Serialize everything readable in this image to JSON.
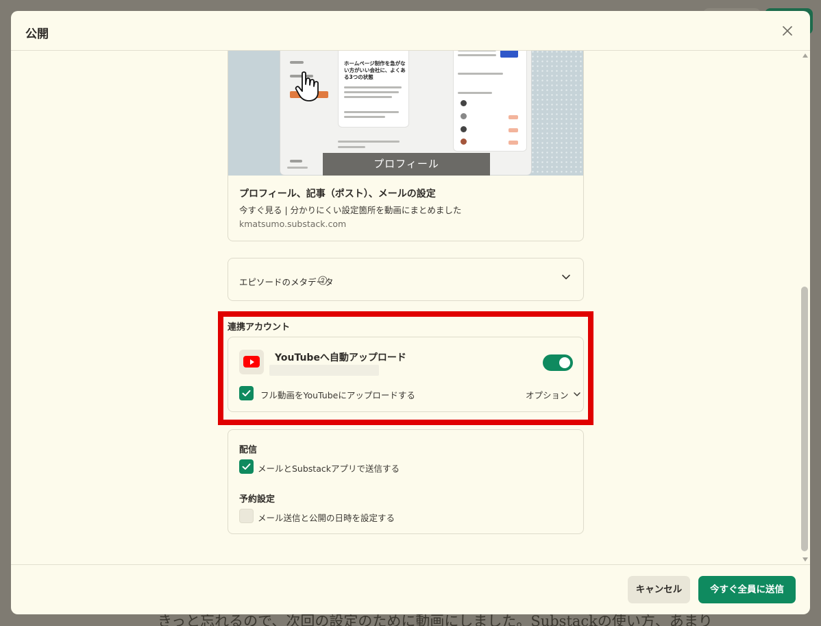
{
  "background": {
    "article_text": "きっと忘れるので、次回の設定のために動画にしました。Substackの使い方、あまり"
  },
  "modal": {
    "title": "公開",
    "close_icon": "close-icon"
  },
  "article_card": {
    "preview": {
      "overlay_label": "プロフィール",
      "feed_headline": "ホームページ制作を急がない方がいい会社に、よくある3つの状態"
    },
    "title": "プロフィール、記事（ポスト）、メールの設定",
    "subtitle": "今すぐ見る | 分かりにくい設定箇所を動画にまとめました",
    "domain": "kmatsumo.substack.com"
  },
  "episode_metadata": {
    "label": "エピソードのメタデータ",
    "help_icon": "question-circle-icon",
    "chevron_icon": "chevron-down-icon"
  },
  "linked_accounts": {
    "section_label": "連携アカウント",
    "youtube": {
      "title": "YouTubeへ自動アップロード",
      "icon": "youtube-icon",
      "enabled": true,
      "full_video_checkbox_label": "フル動画をYouTubeにアップロードする",
      "full_video_checked": true,
      "options_label": "オプション"
    }
  },
  "delivery": {
    "section_label": "配信",
    "send_checkbox_label": "メールとSubstackアプリで送信する",
    "send_checked": true,
    "schedule_label": "予約設定",
    "schedule_checkbox_label": "メール送信と公開の日時を設定する",
    "schedule_checked": false
  },
  "footer": {
    "cancel_label": "キャンセル",
    "send_label": "今すぐ全員に送信"
  },
  "colors": {
    "accent": "#0f8a5f",
    "highlight_border": "#e00000",
    "modal_bg": "#fdfbec",
    "youtube_red": "#ff0000"
  }
}
